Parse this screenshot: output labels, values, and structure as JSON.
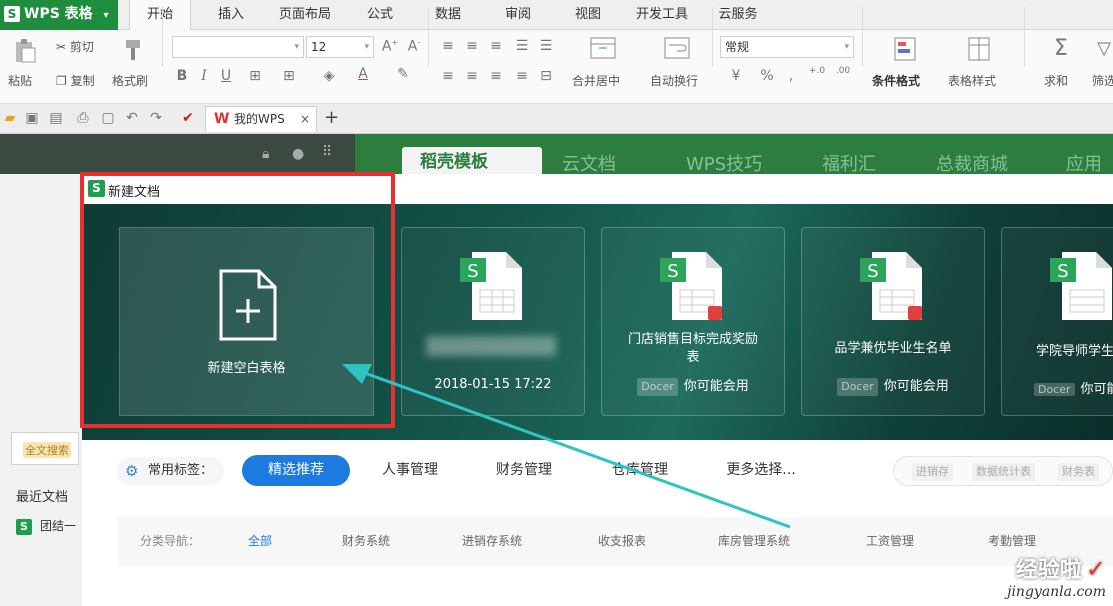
{
  "app": {
    "logo_glyph": "S",
    "name": "WPS 表格",
    "dropdown_glyph": "▾"
  },
  "menu_tabs": [
    "开始",
    "插入",
    "页面布局",
    "公式",
    "数据",
    "审阅",
    "视图",
    "开发工具",
    "云服务"
  ],
  "active_tab": "开始",
  "ribbon": {
    "cut": "剪切",
    "paste": "粘贴",
    "copy": "复制",
    "format_painter": "格式刷",
    "font_name": "",
    "font_size": "12",
    "bold": "B",
    "italic": "I",
    "underline": "U",
    "merge_center": "合并居中",
    "wrap_text": "自动换行",
    "number_format": "常规",
    "percent": "%",
    "conditional_format": "条件格式",
    "table_style": "表格样式",
    "sum": "求和",
    "filter": "筛选"
  },
  "doc_tab": {
    "label": "我的WPS",
    "close": "×",
    "add": "+"
  },
  "background_tabs": [
    "稻壳模板",
    "云文档",
    "WPS技巧",
    "福利汇",
    "总裁商城",
    "应用"
  ],
  "dialog": {
    "title": "新建文档",
    "logo_glyph": "S",
    "new_blank_label": "新建空白表格",
    "plus_glyph": "+",
    "templates": [
      {
        "title": "",
        "date": "2018-01-15 17:22",
        "tag": "",
        "hint": ""
      },
      {
        "title": "门店销售目标完成奖励表",
        "date": "",
        "tag": "Docer",
        "hint": "你可能会用"
      },
      {
        "title": "品学兼优毕业生名单",
        "date": "",
        "tag": "Docer",
        "hint": "你可能会用"
      },
      {
        "title": "学院导师学生",
        "date": "",
        "tag": "Docer",
        "hint": "你可能"
      }
    ]
  },
  "tags": {
    "common_label": "常用标签：",
    "pills": [
      "精选推荐",
      "人事管理",
      "财务管理",
      "仓库管理",
      "更多选择..."
    ],
    "search_tags": [
      "进销存",
      "数据统计表",
      "财务表"
    ]
  },
  "categories": {
    "label": "分类导航：",
    "items": [
      "全部",
      "财务系统",
      "进销存系统",
      "收支报表",
      "库房管理系统",
      "工资管理",
      "考勤管理"
    ]
  },
  "left_pane": {
    "full_search": "全文搜索",
    "recent_docs": "最近文档",
    "recent_file": "团结一"
  },
  "watermark": {
    "line1": "经验啦",
    "check": "✓",
    "line2": "jingyanla.com"
  },
  "colors": {
    "accent_green": "#1e8e3e",
    "highlight_red": "#e8302f",
    "arrow_teal": "#2ec4c4",
    "pill_blue": "#1d7be0"
  }
}
